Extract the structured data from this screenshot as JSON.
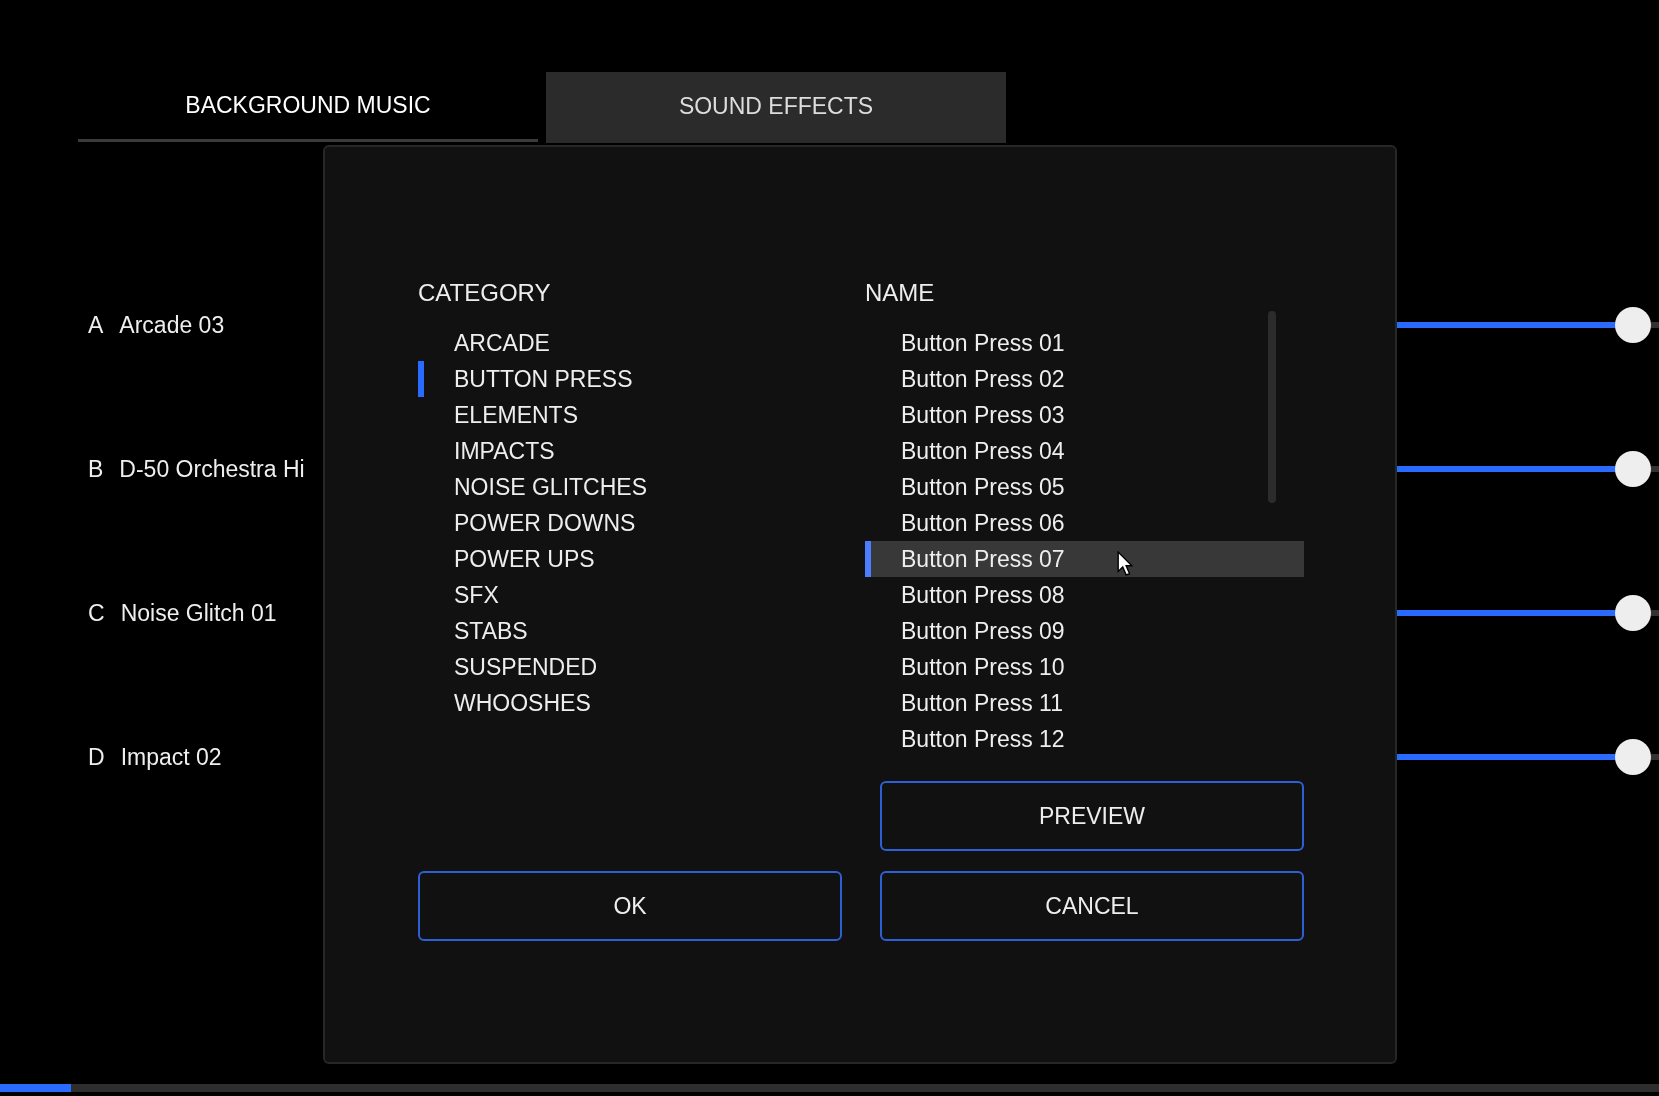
{
  "tabs": [
    {
      "label": "BACKGROUND MUSIC",
      "selected": true
    },
    {
      "label": "SOUND EFFECTS",
      "selected": false
    }
  ],
  "tracks": [
    {
      "letter": "A",
      "name": "Arcade 03",
      "level": 0.98
    },
    {
      "letter": "B",
      "name": "D-50 Orchestra Hi",
      "level": 0.98
    },
    {
      "letter": "C",
      "name": "Noise Glitch 01",
      "level": 0.98
    },
    {
      "letter": "D",
      "name": "Impact 02",
      "level": 0.98
    }
  ],
  "dialog": {
    "category_heading": "CATEGORY",
    "name_heading": "NAME",
    "categories": [
      {
        "label": "ARCADE",
        "selected": false
      },
      {
        "label": "BUTTON PRESS",
        "selected": true
      },
      {
        "label": "ELEMENTS",
        "selected": false
      },
      {
        "label": "IMPACTS",
        "selected": false
      },
      {
        "label": "NOISE GLITCHES",
        "selected": false
      },
      {
        "label": "POWER DOWNS",
        "selected": false
      },
      {
        "label": "POWER UPS",
        "selected": false
      },
      {
        "label": "SFX",
        "selected": false
      },
      {
        "label": "STABS",
        "selected": false
      },
      {
        "label": "SUSPENDED",
        "selected": false
      },
      {
        "label": "WHOOSHES",
        "selected": false
      }
    ],
    "names": [
      {
        "label": "Button Press 01",
        "selected": false
      },
      {
        "label": "Button Press 02",
        "selected": false
      },
      {
        "label": "Button Press 03",
        "selected": false
      },
      {
        "label": "Button Press 04",
        "selected": false
      },
      {
        "label": "Button Press 05",
        "selected": false
      },
      {
        "label": "Button Press 06",
        "selected": false
      },
      {
        "label": "Button Press 07",
        "selected": true
      },
      {
        "label": "Button Press 08",
        "selected": false
      },
      {
        "label": "Button Press 09",
        "selected": false
      },
      {
        "label": "Button Press 10",
        "selected": false
      },
      {
        "label": "Button Press 11",
        "selected": false
      },
      {
        "label": "Button Press 12",
        "selected": false
      }
    ],
    "preview_button": "PREVIEW",
    "ok_button": "OK",
    "cancel_button": "CANCEL"
  },
  "progress": {
    "level": 0.043
  }
}
